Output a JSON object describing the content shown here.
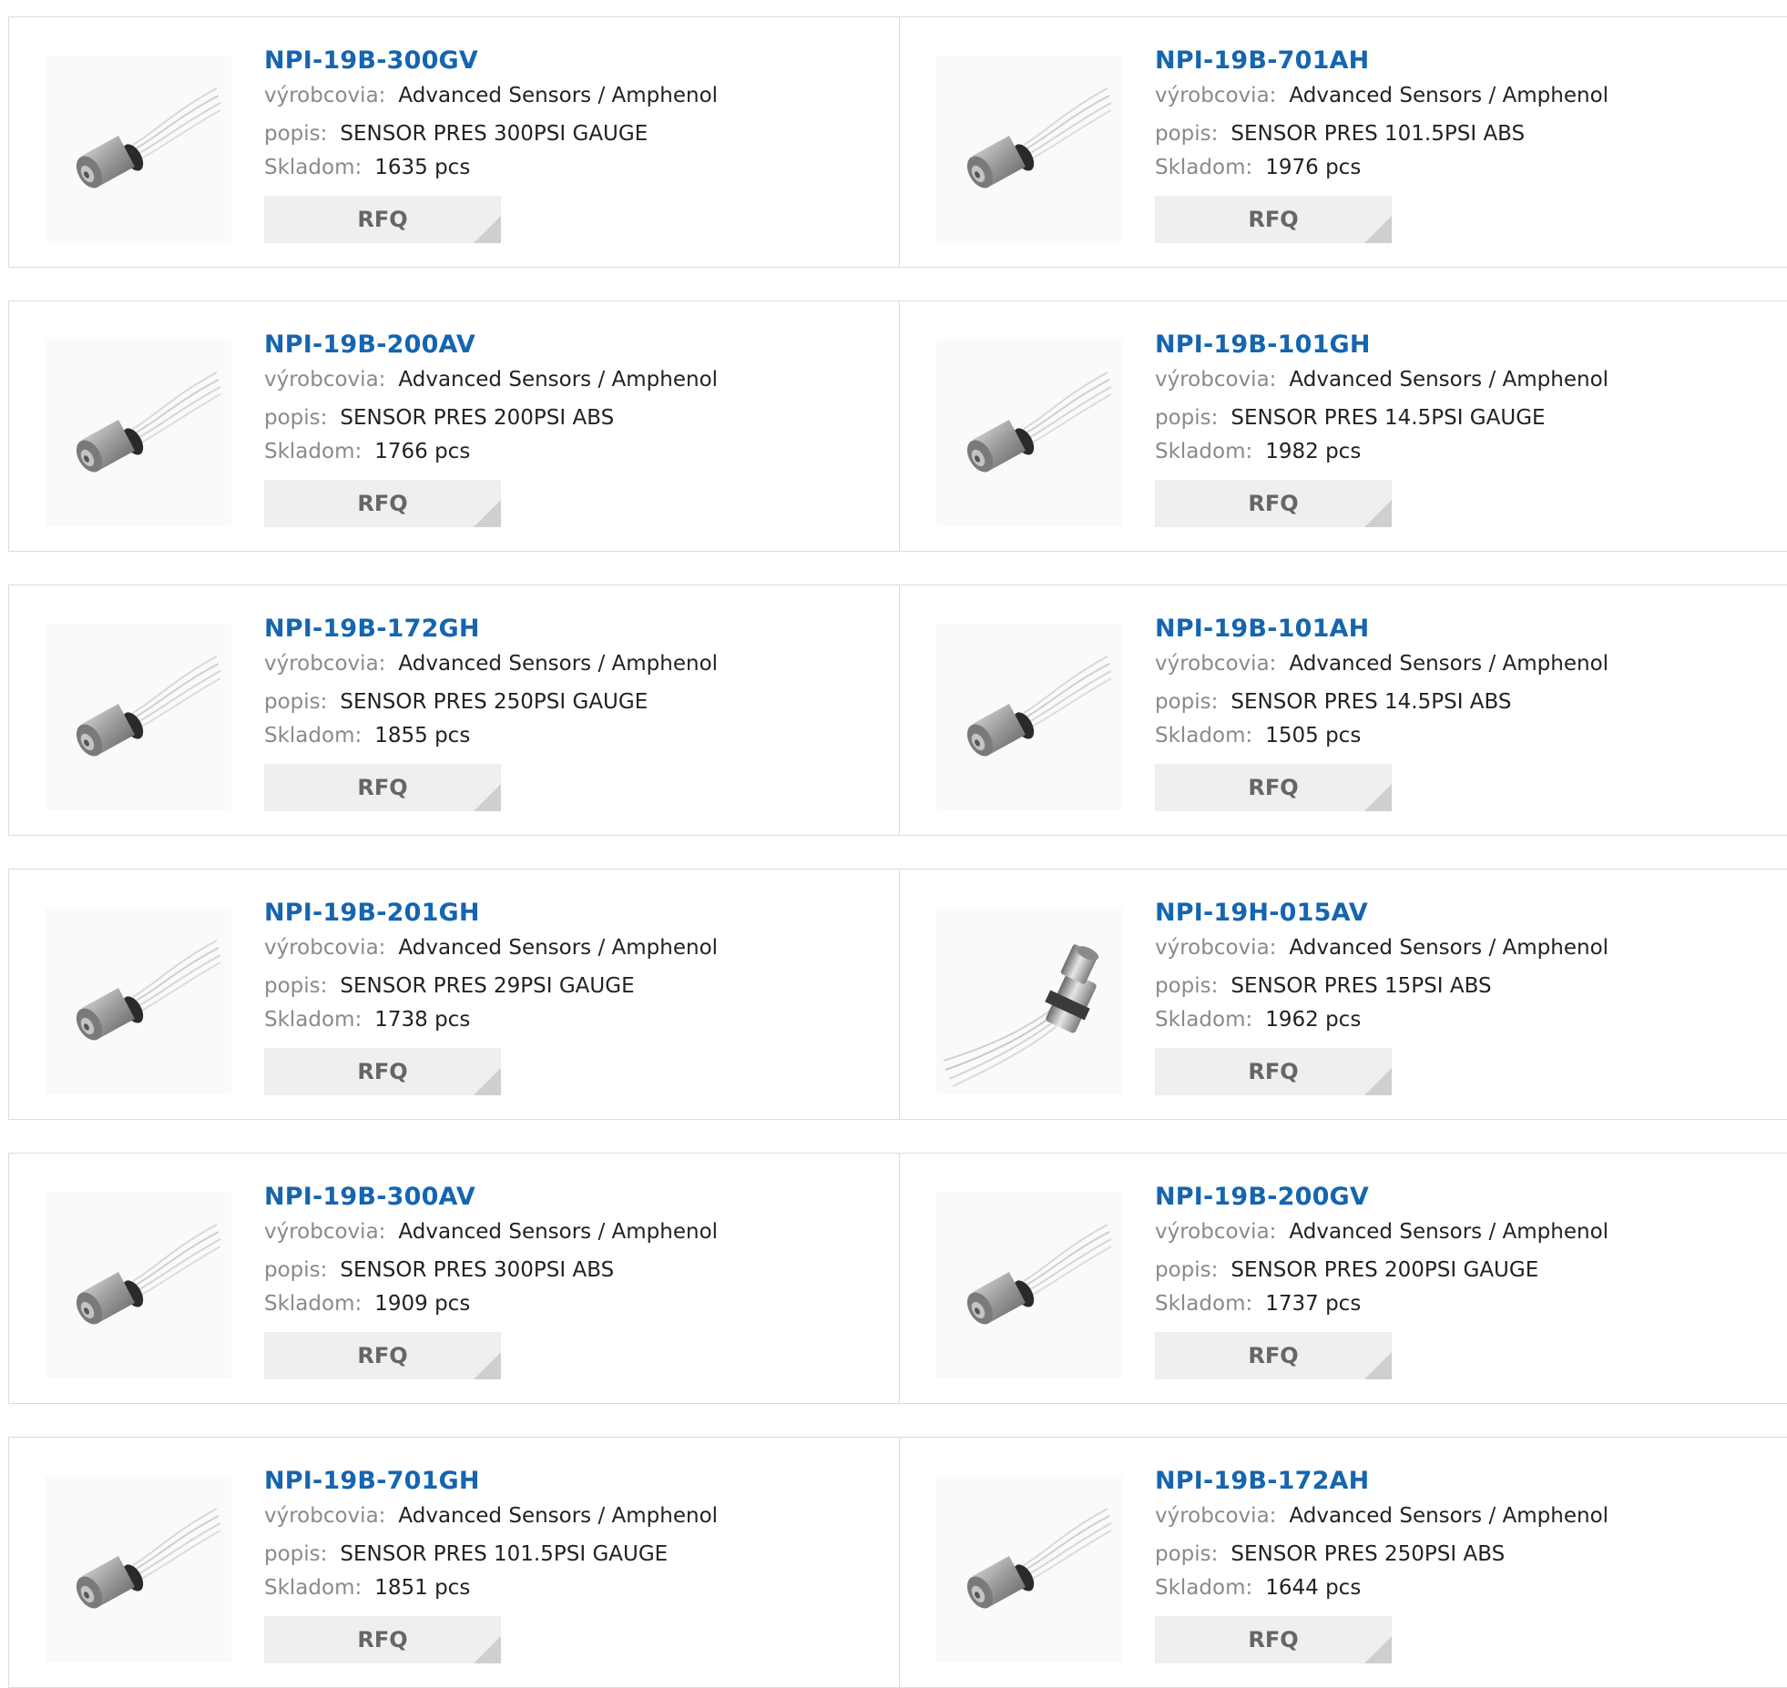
{
  "labels": {
    "manufacturer": "výrobcovia:",
    "description": "popis:",
    "stock": "Skladom:",
    "rfq": "RFQ"
  },
  "products": [
    {
      "part": "NPI-19B-300GV",
      "manufacturer": "Advanced Sensors / Amphenol",
      "description": "SENSOR PRES 300PSI GAUGE",
      "stock": "1635 pcs",
      "image": "pressure-sensor-angled"
    },
    {
      "part": "NPI-19B-701AH",
      "manufacturer": "Advanced Sensors / Amphenol",
      "description": "SENSOR PRES 101.5PSI ABS",
      "stock": "1976 pcs",
      "image": "pressure-sensor-angled"
    },
    {
      "part": "NPI-19B-200AV",
      "manufacturer": "Advanced Sensors / Amphenol",
      "description": "SENSOR PRES 200PSI ABS",
      "stock": "1766 pcs",
      "image": "pressure-sensor-angled"
    },
    {
      "part": "NPI-19B-101GH",
      "manufacturer": "Advanced Sensors / Amphenol",
      "description": "SENSOR PRES 14.5PSI GAUGE",
      "stock": "1982 pcs",
      "image": "pressure-sensor-angled"
    },
    {
      "part": "NPI-19B-172GH",
      "manufacturer": "Advanced Sensors / Amphenol",
      "description": "SENSOR PRES 250PSI GAUGE",
      "stock": "1855 pcs",
      "image": "pressure-sensor-angled"
    },
    {
      "part": "NPI-19B-101AH",
      "manufacturer": "Advanced Sensors / Amphenol",
      "description": "SENSOR PRES 14.5PSI ABS",
      "stock": "1505 pcs",
      "image": "pressure-sensor-angled"
    },
    {
      "part": "NPI-19B-201GH",
      "manufacturer": "Advanced Sensors / Amphenol",
      "description": "SENSOR PRES 29PSI GAUGE",
      "stock": "1738 pcs",
      "image": "pressure-sensor-angled"
    },
    {
      "part": "NPI-19H-015AV",
      "manufacturer": "Advanced Sensors / Amphenol",
      "description": "SENSOR PRES 15PSI ABS",
      "stock": "1962 pcs",
      "image": "pressure-sensor-upright"
    },
    {
      "part": "NPI-19B-300AV",
      "manufacturer": "Advanced Sensors / Amphenol",
      "description": "SENSOR PRES 300PSI ABS",
      "stock": "1909 pcs",
      "image": "pressure-sensor-angled"
    },
    {
      "part": "NPI-19B-200GV",
      "manufacturer": "Advanced Sensors / Amphenol",
      "description": "SENSOR PRES 200PSI GAUGE",
      "stock": "1737 pcs",
      "image": "pressure-sensor-angled"
    },
    {
      "part": "NPI-19B-701GH",
      "manufacturer": "Advanced Sensors / Amphenol",
      "description": "SENSOR PRES 101.5PSI GAUGE",
      "stock": "1851 pcs",
      "image": "pressure-sensor-angled"
    },
    {
      "part": "NPI-19B-172AH",
      "manufacturer": "Advanced Sensors / Amphenol",
      "description": "SENSOR PRES 250PSI ABS",
      "stock": "1644 pcs",
      "image": "pressure-sensor-angled"
    }
  ]
}
